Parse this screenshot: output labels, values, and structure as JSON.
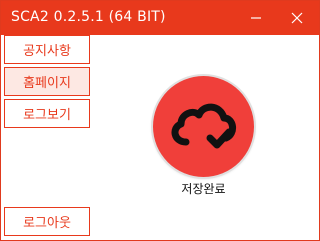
{
  "window": {
    "title": "SCA2 0.2.5.1 (64 BIT)",
    "accent_color": "#e8391c"
  },
  "controls": {
    "minimize_icon": "minimize-icon",
    "close_icon": "close-icon"
  },
  "menu": {
    "notice_label": "공지사항",
    "homepage_label": "홈페이지",
    "viewlog_label": "로그보기",
    "logout_label": "로그아웃",
    "active_item": "홈페이지"
  },
  "status": {
    "icon": "cloud-check-icon",
    "text": "저장완료",
    "circle_color": "#f03f3a"
  }
}
